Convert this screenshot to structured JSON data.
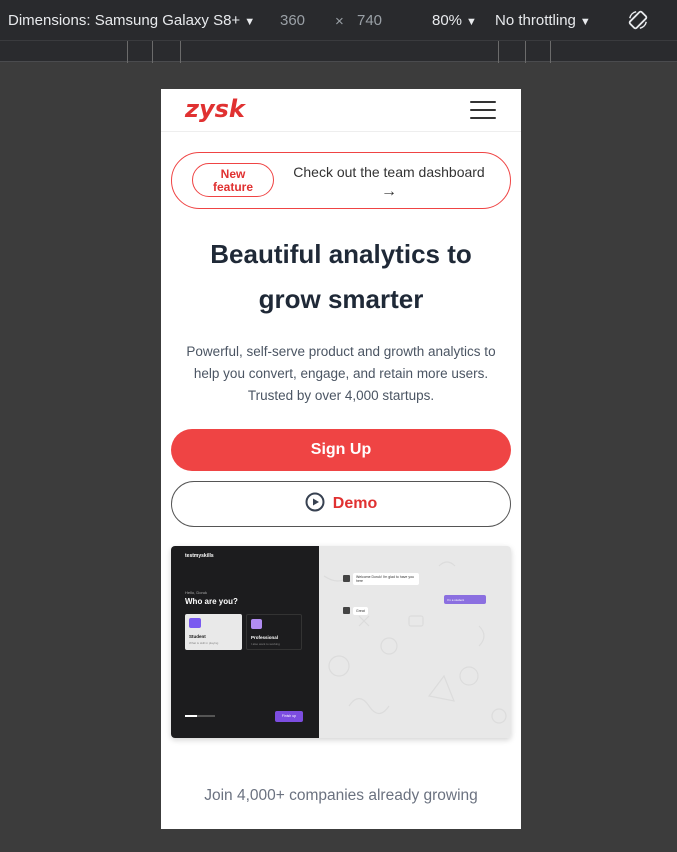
{
  "devtools": {
    "dimensions_label": "Dimensions: Samsung Galaxy S8+",
    "width": "360",
    "times": "×",
    "height": "740",
    "zoom": "80%",
    "throttling": "No throttling",
    "caret": "▼"
  },
  "site": {
    "logo_text": "zysk",
    "brand_color": "#ef4444",
    "banner": {
      "badge_line1": "New",
      "badge_line2": "feature",
      "text": "Check out the team dashboard",
      "arrow": "→"
    },
    "headline": "Beautiful analytics to grow smarter",
    "subtext": "Powerful, self-serve product and growth analytics to help you convert, engage, and retain more users. Trusted by over 4,000 startups.",
    "primary_cta": "Sign Up",
    "secondary_cta": "Demo",
    "preview": {
      "brand": "testmyskills",
      "hello": "Hello, Doruk",
      "question": "Who are you?",
      "card1_title": "Student",
      "card1_sub": "What is skill in playing",
      "card2_title": "Professional",
      "card2_sub": "I also want to working",
      "next_button": "Finish up",
      "bot_msg1": "Welcome Doruk! I'm glad to have you here",
      "user_reply": "I'm a student",
      "bot_msg2": "Great",
      "progress": 0.4
    },
    "join_text": "Join 4,000+ companies already growing"
  }
}
